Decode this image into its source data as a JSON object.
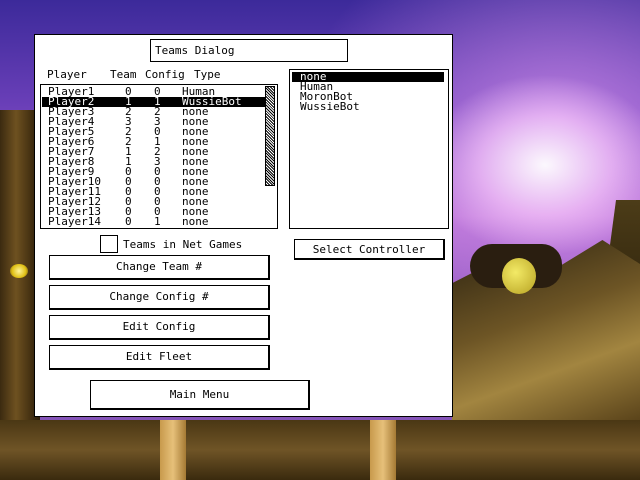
{
  "dialog": {
    "title": "Teams Dialog",
    "headers": {
      "player": "Player",
      "team": "Team",
      "config": "Config",
      "type": "Type"
    },
    "players": [
      {
        "name": "Player1",
        "team": "0",
        "config": "0",
        "type": "Human"
      },
      {
        "name": "Player2",
        "team": "1",
        "config": "1",
        "type": "WussieBot"
      },
      {
        "name": "Player3",
        "team": "2",
        "config": "2",
        "type": "none"
      },
      {
        "name": "Player4",
        "team": "3",
        "config": "3",
        "type": "none"
      },
      {
        "name": "Player5",
        "team": "2",
        "config": "0",
        "type": "none"
      },
      {
        "name": "Player6",
        "team": "2",
        "config": "1",
        "type": "none"
      },
      {
        "name": "Player7",
        "team": "1",
        "config": "2",
        "type": "none"
      },
      {
        "name": "Player8",
        "team": "1",
        "config": "3",
        "type": "none"
      },
      {
        "name": "Player9",
        "team": "0",
        "config": "0",
        "type": "none"
      },
      {
        "name": "Player10",
        "team": "0",
        "config": "0",
        "type": "none"
      },
      {
        "name": "Player11",
        "team": "0",
        "config": "0",
        "type": "none"
      },
      {
        "name": "Player12",
        "team": "0",
        "config": "0",
        "type": "none"
      },
      {
        "name": "Player13",
        "team": "0",
        "config": "0",
        "type": "none"
      },
      {
        "name": "Player14",
        "team": "0",
        "config": "1",
        "type": "none"
      }
    ],
    "selected_player": "Player2",
    "controllers": [
      "none",
      "Human",
      "MoronBot",
      "WussieBot"
    ],
    "selected_controller": "none",
    "teams_in_net_games_label": "Teams in Net Games",
    "teams_in_net_games_checked": false,
    "buttons": {
      "select_controller": "Select Controller",
      "change_team": "Change Team #",
      "change_config": "Change Config #",
      "edit_config": "Edit Config",
      "edit_fleet": "Edit Fleet",
      "main_menu": "Main Menu"
    }
  }
}
